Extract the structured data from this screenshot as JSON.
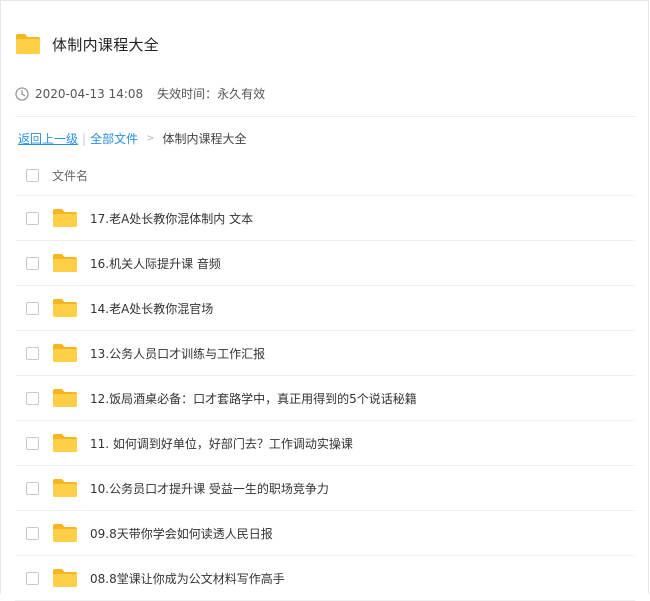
{
  "folder": {
    "title": "体制内课程大全",
    "icon": "folder-icon",
    "folder_color": "#ffc83d"
  },
  "meta": {
    "icon": "clock-icon",
    "date": "2020-04-13 14:08",
    "expiry": "失效时间：永久有效"
  },
  "breadcrumb": {
    "back": "返回上一级",
    "separator": "|",
    "all_files": "全部文件",
    "arrow": ">",
    "current": "体制内课程大全"
  },
  "list": {
    "column_header": "文件名",
    "items": [
      {
        "name": "17.老A处长教你混体制内 文本"
      },
      {
        "name": "16.机关人际提升课 音频"
      },
      {
        "name": "14.老A处长教你混官场"
      },
      {
        "name": "13.公务人员口才训练与工作汇报"
      },
      {
        "name": "12.饭局酒桌必备：口才套路学中，真正用得到的5个说话秘籍"
      },
      {
        "name": "11. 如何调到好单位，好部门去？工作调动实操课"
      },
      {
        "name": "10.公务员口才提升课 受益一生的职场竞争力"
      },
      {
        "name": "09.8天带你学会如何读透人民日报"
      },
      {
        "name": "08.8堂课让你成为公文材料写作高手"
      }
    ]
  },
  "colors": {
    "link": "#2a8fe4",
    "folder": "#ffc83d",
    "divider": "#eeeeee"
  }
}
